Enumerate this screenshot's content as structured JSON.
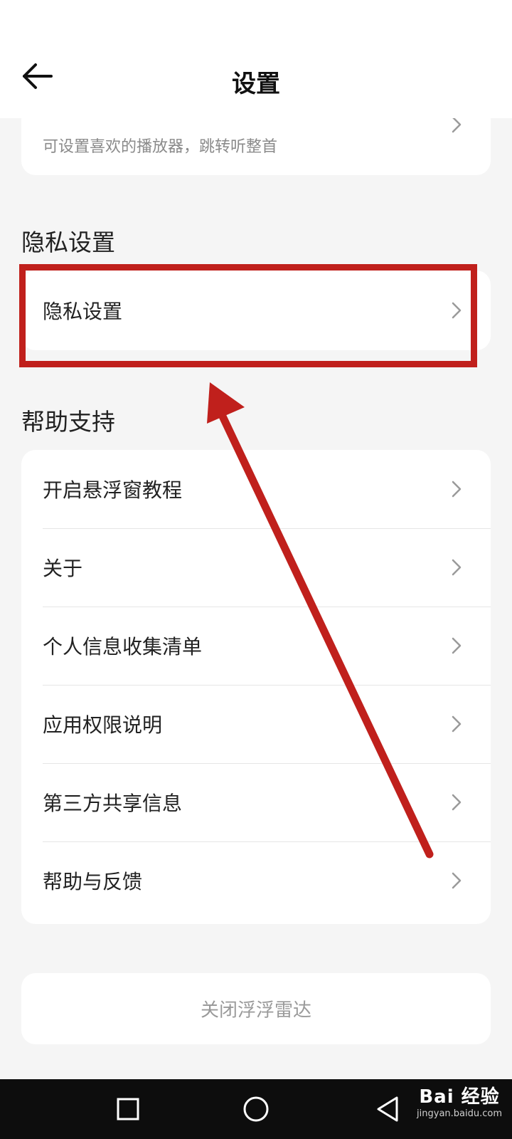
{
  "header": {
    "title": "设置"
  },
  "previous_item": {
    "label": "",
    "description": "可设置喜欢的播放器，跳转听整首"
  },
  "privacy_section": {
    "title": "隐私设置",
    "items": [
      {
        "label": "隐私设置"
      }
    ]
  },
  "help_section": {
    "title": "帮助支持",
    "items": [
      {
        "label": "开启悬浮窗教程"
      },
      {
        "label": "关于"
      },
      {
        "label": "个人信息收集清单"
      },
      {
        "label": "应用权限说明"
      },
      {
        "label": "第三方共享信息"
      },
      {
        "label": "帮助与反馈"
      }
    ]
  },
  "close_button": {
    "label": "关闭浮浮雷达"
  },
  "watermark": {
    "main": "Bai 经验",
    "sub": "jingyan.baidu.com"
  },
  "colors": {
    "annotation": "#c0201c",
    "background": "#f5f5f5",
    "card": "#ffffff"
  },
  "icons": [
    "back-arrow-icon",
    "chevron-right-icon",
    "square-icon",
    "circle-icon",
    "triangle-back-icon"
  ]
}
